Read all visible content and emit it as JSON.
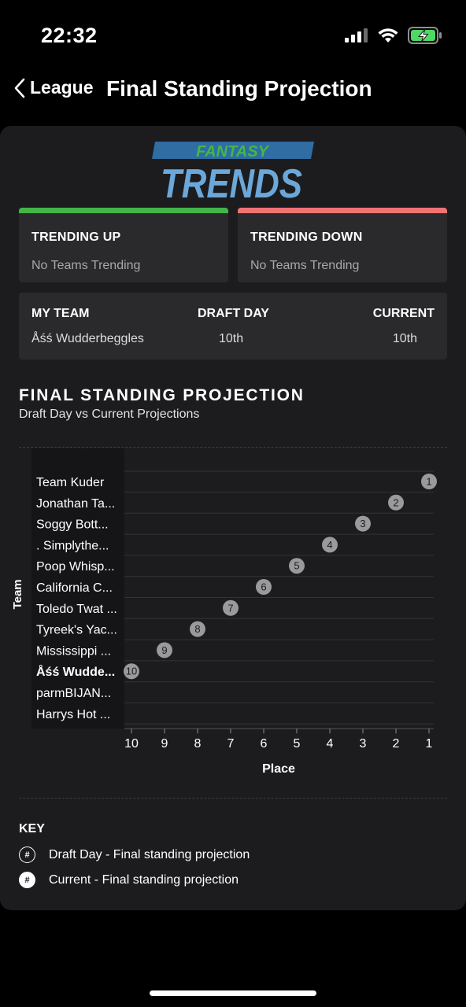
{
  "status": {
    "time": "22:32"
  },
  "nav": {
    "back_label": "League",
    "title": "Final Standing Projection"
  },
  "logo": {
    "line1": "FANTASY",
    "line2": "TRENDS"
  },
  "trending_up": {
    "title": "TRENDING UP",
    "text": "No Teams Trending",
    "accent": "#43b649"
  },
  "trending_down": {
    "title": "TRENDING DOWN",
    "text": "No Teams Trending",
    "accent": "#f07474"
  },
  "my_team": {
    "headers": [
      "MY TEAM",
      "DRAFT DAY",
      "CURRENT"
    ],
    "name": "Åśś Wudderbeggles",
    "draft_day": "10th",
    "current": "10th"
  },
  "section": {
    "title": "FINAL STANDING PROJECTION",
    "subtitle": "Draft Day vs Current Projections"
  },
  "chart_data": {
    "type": "scatter",
    "ylabel": "Team",
    "xlabel": "Place",
    "x_ticks": [
      "10",
      "9",
      "8",
      "7",
      "6",
      "5",
      "4",
      "3",
      "2",
      "1"
    ],
    "teams": [
      "Team Kuder",
      "Jonathan Ta...",
      "Soggy Bott...",
      ". Simplythe...",
      "Poop Whisp...",
      "California C...",
      "Toledo Twat ...",
      "Tyreek's Yac...",
      "Mississippi ...",
      "Åśś Wudde...",
      "parmBIJAN...",
      "Harrys Hot ..."
    ],
    "highlight_team": "Åśś Wudde...",
    "series": [
      {
        "teams": [
          "Team Kuder",
          "Jonathan Ta...",
          "Soggy Bott...",
          ". Simplythe...",
          "Poop Whisp...",
          "California C...",
          "Toledo Twat ...",
          "Tyreek's Yac...",
          "Mississippi ...",
          "Åśś Wudde..."
        ],
        "values": [
          1,
          2,
          3,
          4,
          5,
          6,
          7,
          8,
          9,
          10
        ]
      }
    ],
    "grid": true,
    "marker_color": "#9a9a9c"
  },
  "key": {
    "title": "KEY",
    "badge_symbol": "#",
    "items": [
      "Draft Day - Final standing projection",
      "Current - Final standing projection"
    ]
  }
}
